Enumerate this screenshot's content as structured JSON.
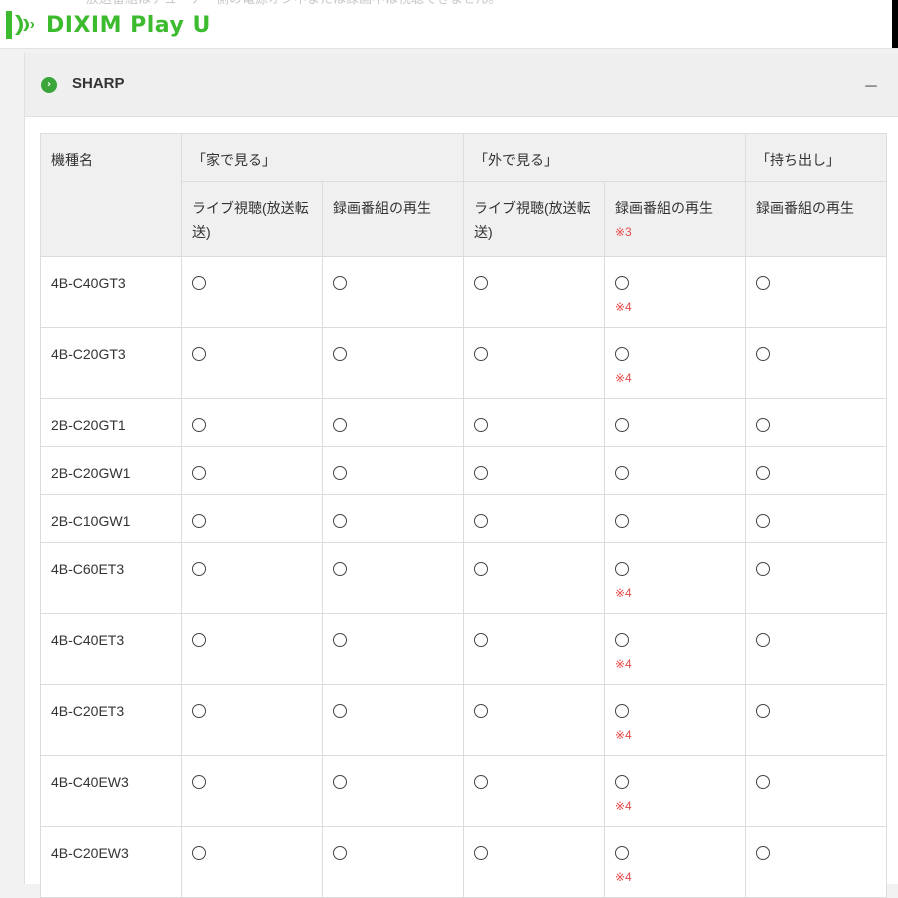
{
  "header": {
    "ghost_text": "放送番組はチューナー側の電源オン中または録画中は視聴できません。",
    "logo_text": "DIXIM Play U",
    "brand_color": "#3dbb2f"
  },
  "accordion": {
    "title": "SHARP",
    "toggle_label": "－",
    "chevron_icon": "chevron-right-icon"
  },
  "table": {
    "col_model": "機種名",
    "group_home": "「家で見る」",
    "group_out": "「外で見る」",
    "group_takeout": "「持ち出し」",
    "sub_live": "ライブ視聴(放送転送)",
    "sub_recorded": "録画番組の再生",
    "note3": "※3",
    "note4": "※4",
    "available_symbol": "〇",
    "rows": [
      {
        "model": "4B-C40GT3",
        "note": "※4"
      },
      {
        "model": "4B-C20GT3",
        "note": "※4"
      },
      {
        "model": "2B-C20GT1",
        "note": ""
      },
      {
        "model": "2B-C20GW1",
        "note": ""
      },
      {
        "model": "2B-C10GW1",
        "note": ""
      },
      {
        "model": "4B-C60ET3",
        "note": "※4"
      },
      {
        "model": "4B-C40ET3",
        "note": "※4"
      },
      {
        "model": "4B-C20ET3",
        "note": "※4"
      },
      {
        "model": "4B-C40EW3",
        "note": "※4"
      },
      {
        "model": "4B-C20EW3",
        "note": "※4"
      }
    ]
  }
}
